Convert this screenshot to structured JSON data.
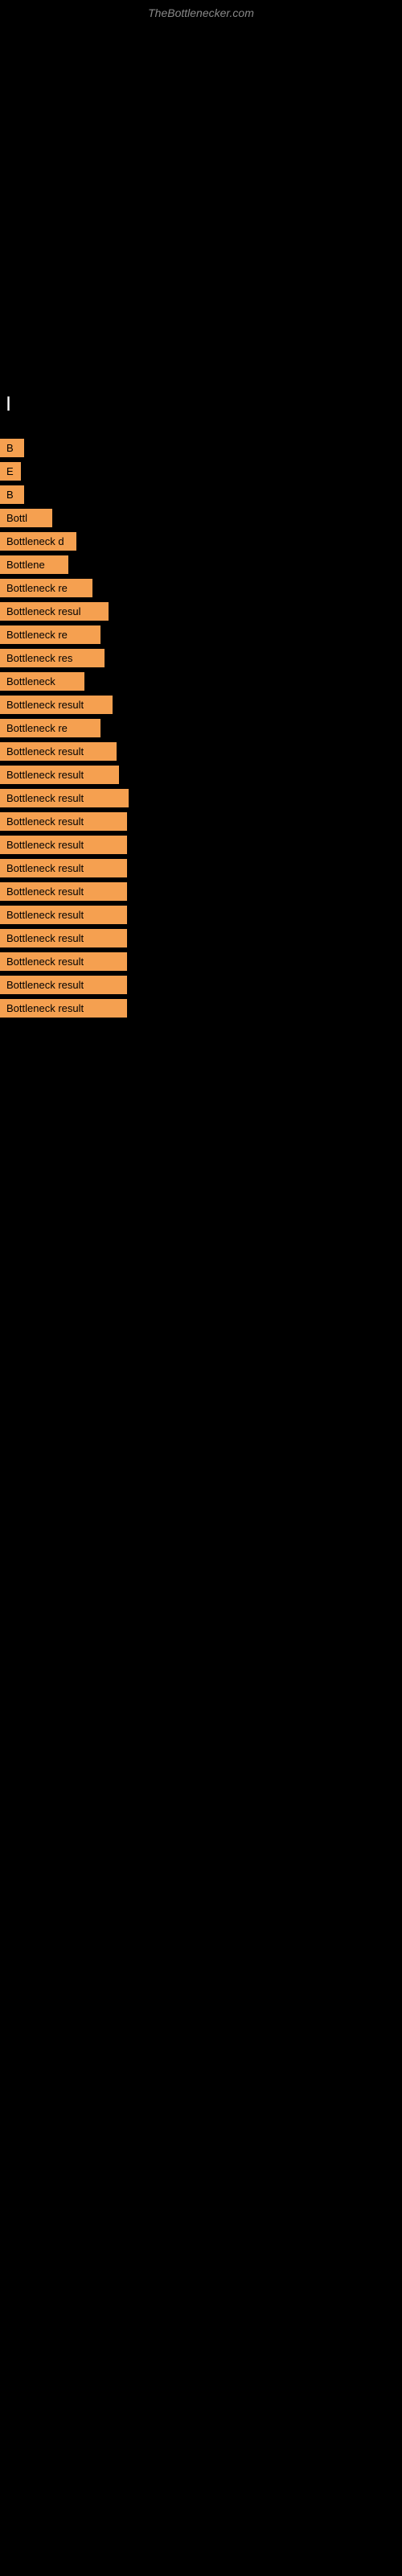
{
  "site": {
    "title": "TheBottlenecker.com"
  },
  "page_indicator": "|",
  "items": [
    {
      "id": 1,
      "label": "B",
      "class": "item-1"
    },
    {
      "id": 2,
      "label": "E",
      "class": "item-2"
    },
    {
      "id": 3,
      "label": "B",
      "class": "item-3"
    },
    {
      "id": 4,
      "label": "Bottl",
      "class": "item-4"
    },
    {
      "id": 5,
      "label": "Bottleneck d",
      "class": "item-5"
    },
    {
      "id": 6,
      "label": "Bottlene",
      "class": "item-6"
    },
    {
      "id": 7,
      "label": "Bottleneck re",
      "class": "item-7"
    },
    {
      "id": 8,
      "label": "Bottleneck resul",
      "class": "item-8"
    },
    {
      "id": 9,
      "label": "Bottleneck re",
      "class": "item-9"
    },
    {
      "id": 10,
      "label": "Bottleneck res",
      "class": "item-10"
    },
    {
      "id": 11,
      "label": "Bottleneck",
      "class": "item-11"
    },
    {
      "id": 12,
      "label": "Bottleneck result",
      "class": "item-12"
    },
    {
      "id": 13,
      "label": "Bottleneck re",
      "class": "item-13"
    },
    {
      "id": 14,
      "label": "Bottleneck result",
      "class": "item-14"
    },
    {
      "id": 15,
      "label": "Bottleneck result",
      "class": "item-15"
    },
    {
      "id": 16,
      "label": "Bottleneck result",
      "class": "item-16"
    },
    {
      "id": 17,
      "label": "Bottleneck result",
      "class": "item-17"
    },
    {
      "id": 18,
      "label": "Bottleneck result",
      "class": "item-18"
    },
    {
      "id": 19,
      "label": "Bottleneck result",
      "class": "item-19"
    },
    {
      "id": 20,
      "label": "Bottleneck result",
      "class": "item-20"
    },
    {
      "id": 21,
      "label": "Bottleneck result",
      "class": "item-21"
    },
    {
      "id": 22,
      "label": "Bottleneck result",
      "class": "item-22"
    },
    {
      "id": 23,
      "label": "Bottleneck result",
      "class": "item-23"
    },
    {
      "id": 24,
      "label": "Bottleneck result",
      "class": "item-24"
    },
    {
      "id": 25,
      "label": "Bottleneck result",
      "class": "item-25"
    }
  ]
}
